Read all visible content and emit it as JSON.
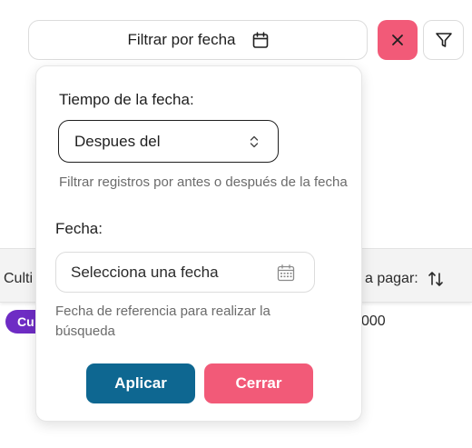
{
  "toolbar": {
    "filter_date_label": "Filtrar por fecha",
    "filter_date_icon": "calendar-icon",
    "clear_icon": "close-icon",
    "funnel_icon": "funnel-icon",
    "accent_color": "#f25a78"
  },
  "popover": {
    "time_label": "Tiempo de la fecha:",
    "time_select_value": "Despues del",
    "time_help": "Filtrar registros por antes o después de la fecha",
    "date_label": "Fecha:",
    "date_placeholder": "Selecciona una fecha",
    "date_help": "Fecha de referencia para realizar la búsqueda",
    "apply_label": "Aplicar",
    "close_label": "Cerrar",
    "apply_color": "#0e6791",
    "close_color": "#f25a78"
  },
  "table": {
    "header_left": "Culti",
    "header_right": "a pagar:",
    "badge_text": "Cu",
    "amount_fragment": "000",
    "badge_color": "#6e2cc4"
  }
}
